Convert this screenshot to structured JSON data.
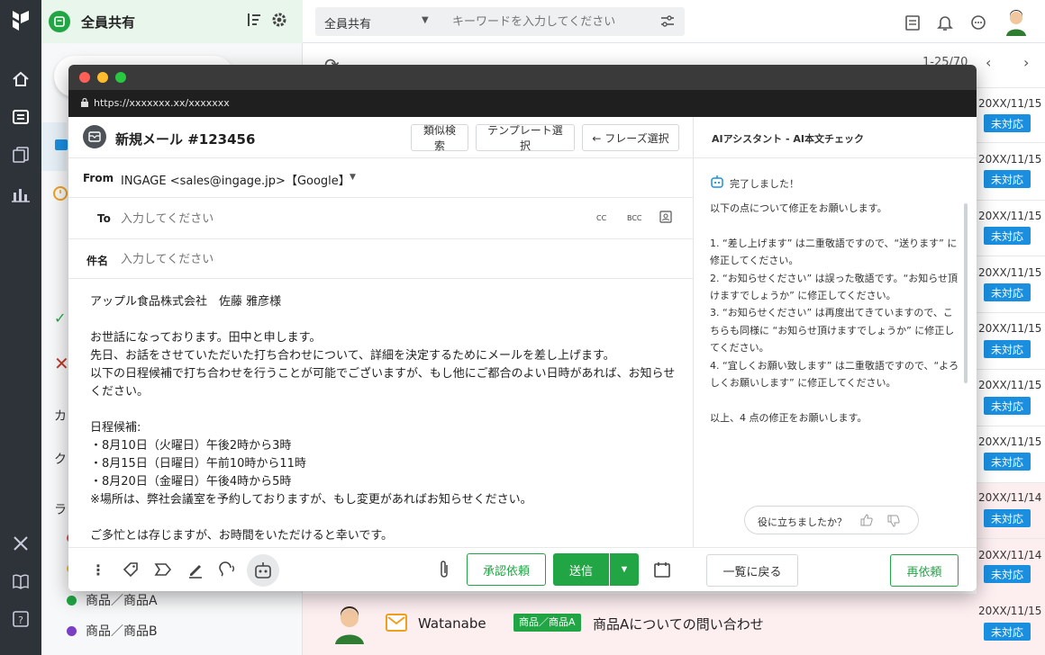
{
  "team": {
    "name": "全員共有"
  },
  "search": {
    "scope": "全員共有",
    "placeholder": "キーワードを入力してください"
  },
  "sidebar": {
    "partial_labels": [
      "カ",
      "ク",
      "ラ"
    ],
    "categories": [
      {
        "label": "商品／商品A",
        "color": "#22a545"
      },
      {
        "label": "商品／商品B",
        "color": "#7b3fc4"
      }
    ]
  },
  "list": {
    "pager": "1-25/70",
    "rows": [
      {
        "date": "20XX/11/15",
        "status": "未対応"
      },
      {
        "date": "20XX/11/15",
        "status": "未対応"
      },
      {
        "date": "20XX/11/15",
        "status": "未対応"
      },
      {
        "date": "20XX/11/15",
        "status": "未対応"
      },
      {
        "date": "20XX/11/15",
        "status": "未対応"
      },
      {
        "date": "20XX/11/15",
        "status": "未対応"
      },
      {
        "date": "20XX/11/15",
        "status": "未対応"
      },
      {
        "date": "20XX/11/14",
        "status": "未対応"
      },
      {
        "date": "20XX/11/14",
        "status": "未対応"
      }
    ],
    "bottom_row": {
      "sender": "Watanabe",
      "tag": "商品／商品A",
      "subject": "商品Aについての問い合わせ",
      "date": "20XX/11/15",
      "status": "未対応"
    }
  },
  "window": {
    "url": "https://xxxxxxx.xx/xxxxxxx"
  },
  "compose": {
    "title": "新規メール #123456",
    "buttons": {
      "similar": "類似検索",
      "template": "テンプレート選択",
      "phrase": "← フレーズ選択"
    },
    "from_label": "From",
    "from_value": "INGAGE <sales@ingage.jp>【Google】",
    "to_label": "To",
    "to_placeholder": "入力してください",
    "cc": "CC",
    "bcc": "BCC",
    "subject_label": "件名",
    "subject_placeholder": "入力してください",
    "body": "アップル食品株式会社　佐藤 雅彦様\n\nお世話になっております。田中と申します。\n先日、お話をさせていただいた打ち合わせについて、詳細を決定するためにメールを差し上げます。\n以下の日程候補で打ち合わせを行うことが可能でございますが、もし他にご都合のよい日時があれば、お知らせください。\n\n日程候補:\n・8月10日（火曜日）午後2時から3時\n・8月15日（日曜日）午前10時から11時\n・8月20日（金曜日）午後4時から5時\n※場所は、弊社会議室を予約しておりますが、もし変更があればお知らせください。\n\nご多忙とは存じますが、お時間をいただけると幸いです。",
    "approve": "承認依頼",
    "send": "送信"
  },
  "assistant": {
    "title": "AIアシスタント - AI本文チェック",
    "status": "完了しました！",
    "message": "以下の点について修正をお願いします。\n\n1. “差し上げます” は二重敬語ですので、“送ります” に修正してください。\n2. “お知らせください” は誤った敬語です。“お知らせ頂けますでしょうか” に修正してください。\n3. “お知らせください” は再度出てきていますので、こちらも同様に “お知らせ頂けますでしょうか” に修正してください。\n4. “宜しくお願い致します” は二重敬語ですので、“よろしくお願いします” に修正してください。\n\n以上、4 点の修正をお願いします。",
    "feedback": "役に立ちましたか？",
    "back": "一覧に戻る",
    "retry": "再依頼"
  },
  "colors": {
    "accent": "#22a545",
    "badge": "#1a8fe0",
    "rail": "#2d3338"
  }
}
